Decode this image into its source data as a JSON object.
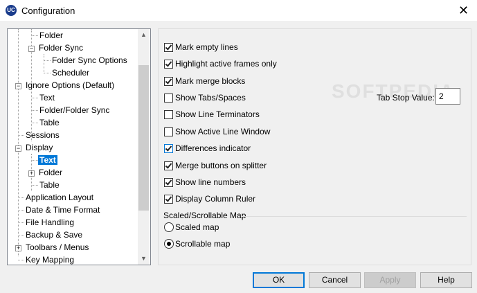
{
  "window": {
    "title": "Configuration",
    "close_glyph": "✕",
    "app_icon_text": "UC"
  },
  "tree": {
    "items": [
      {
        "label": "Folder"
      },
      {
        "label": "Folder Sync"
      },
      {
        "label": "Folder Sync Options"
      },
      {
        "label": "Scheduler"
      },
      {
        "label": "Ignore Options (Default)"
      },
      {
        "label": "Text"
      },
      {
        "label": "Folder/Folder Sync"
      },
      {
        "label": "Table"
      },
      {
        "label": "Sessions"
      },
      {
        "label": "Display"
      },
      {
        "label": "Text"
      },
      {
        "label": "Folder"
      },
      {
        "label": "Table"
      },
      {
        "label": "Application Layout"
      },
      {
        "label": "Date & Time Format"
      },
      {
        "label": "File Handling"
      },
      {
        "label": "Backup & Save"
      },
      {
        "label": "Toolbars / Menus"
      },
      {
        "label": "Key Mapping"
      }
    ],
    "selected_index": 10,
    "expand_glyph_plus": "+",
    "expand_glyph_minus": "−",
    "scroll_up": "▲",
    "scroll_down": "▼"
  },
  "options": {
    "checkboxes": [
      {
        "label": "Mark empty lines",
        "checked": true
      },
      {
        "label": "Highlight active frames only",
        "checked": true
      },
      {
        "label": "Mark merge blocks",
        "checked": true
      },
      {
        "label": "Show Tabs/Spaces",
        "checked": false
      },
      {
        "label": "Show Line Terminators",
        "checked": false
      },
      {
        "label": "Show Active Line Window",
        "checked": false
      },
      {
        "label": "Differences indicator",
        "checked": true
      },
      {
        "label": "Merge buttons on splitter",
        "checked": true
      },
      {
        "label": "Show line numbers",
        "checked": true
      },
      {
        "label": "Display Column Ruler",
        "checked": true
      }
    ],
    "tab_stop_label": "Tab Stop Value:",
    "tab_stop_value": "2",
    "map_group_label": "Scaled/Scrollable Map",
    "radios": [
      {
        "label": "Scaled map",
        "selected": false
      },
      {
        "label": "Scrollable map",
        "selected": true
      }
    ],
    "watermark": "SOFTPEDIA"
  },
  "buttons": {
    "ok": "OK",
    "cancel": "Cancel",
    "apply": "Apply",
    "help": "Help"
  },
  "colors": {
    "selection": "#0078d7",
    "accent": "#0078d7"
  }
}
